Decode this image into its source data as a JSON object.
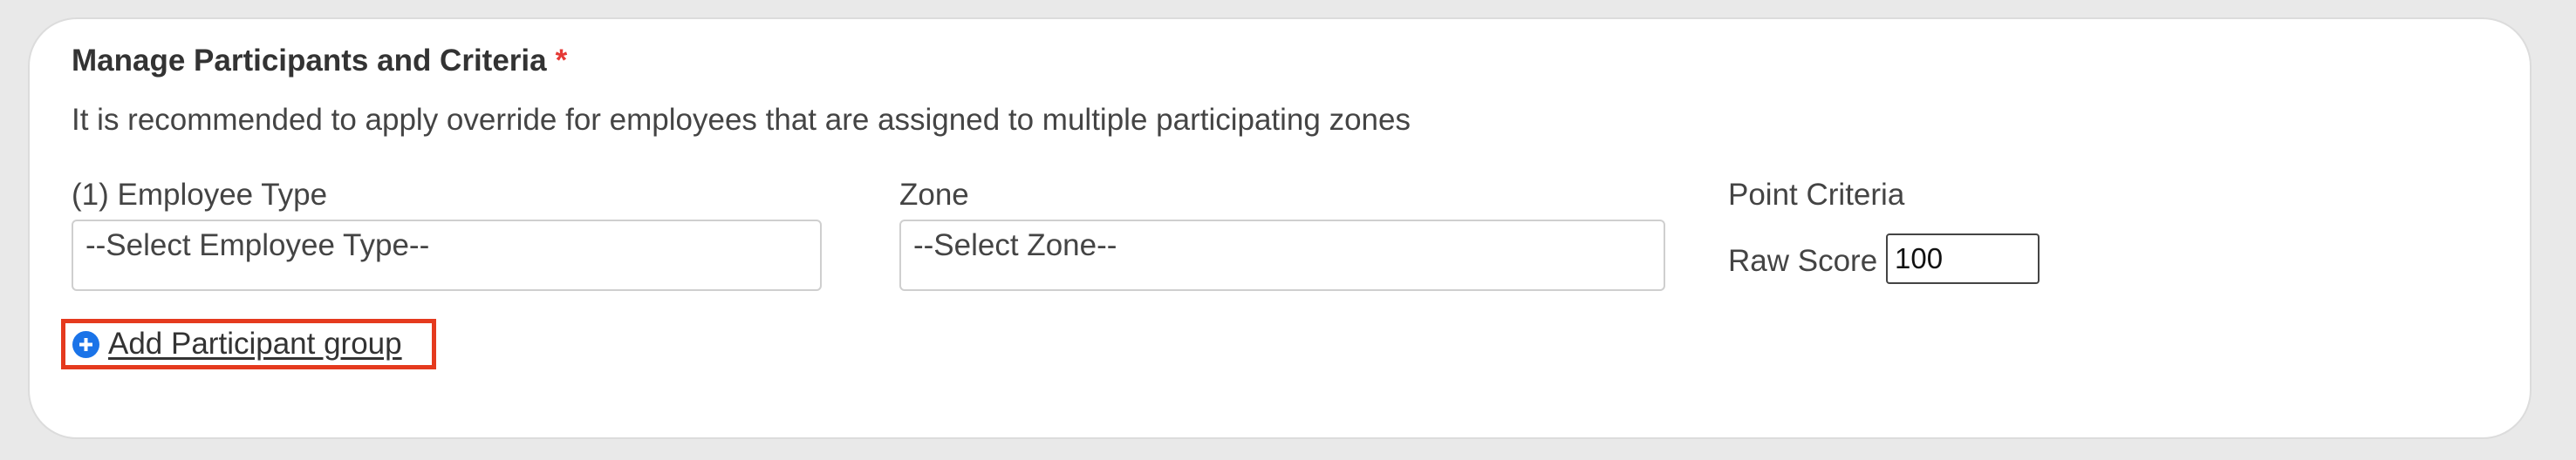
{
  "section": {
    "title": "Manage Participants and Criteria",
    "required_mark": "*",
    "description": "It is recommended to apply override for employees that are assigned to multiple participating zones"
  },
  "fields": {
    "employee_type": {
      "label": "(1) Employee Type",
      "selected": "--Select Employee Type--"
    },
    "zone": {
      "label": "Zone",
      "selected": "--Select Zone--"
    },
    "point_criteria": {
      "label": "Point Criteria",
      "raw_score_label": "Raw Score",
      "raw_score_value": "100"
    }
  },
  "actions": {
    "add_group_label": "Add Participant group",
    "add_group_icon": "plus-circle-icon"
  },
  "colors": {
    "required": "#e53935",
    "highlight_border": "#e53a1e",
    "icon_blue": "#1a73e8"
  }
}
